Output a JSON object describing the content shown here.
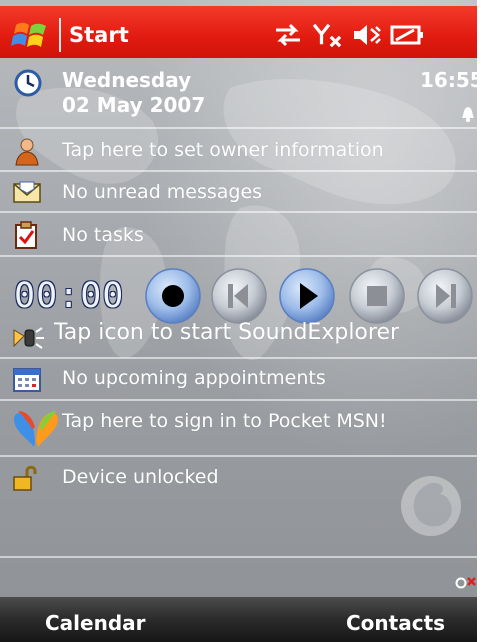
{
  "status_bar": {
    "title": "Start",
    "icons": [
      "windows-start-icon",
      "data-connection-icon",
      "no-signal-icon",
      "speaker-muted-icon",
      "battery-icon"
    ]
  },
  "today": {
    "day": "Wednesday",
    "date": "02 May 2007",
    "time": "16:55",
    "owner_info": "Tap here to set owner information",
    "messages": "No unread messages",
    "tasks": "No tasks",
    "timer": "00:00",
    "soundexplorer": "Tap icon to start SoundExplorer",
    "appointments": "No upcoming appointments",
    "msn": "Tap here to sign in to Pocket MSN!",
    "device_lock": "Device unlocked"
  },
  "softkeys": {
    "left": "Calendar",
    "right": "Contacts"
  },
  "colors": {
    "title_bar": "#e21b10",
    "softkey_bar": "#2b2b2b",
    "media_button": "#8fb3e6"
  }
}
